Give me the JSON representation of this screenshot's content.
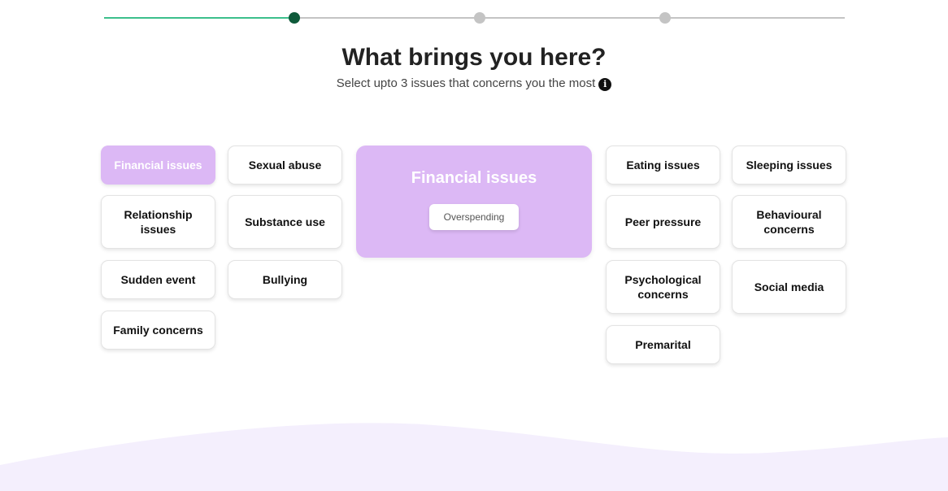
{
  "progress": {
    "current_step": 2,
    "total_steps": 4,
    "fill_fraction": 0.257
  },
  "header": {
    "title": "What brings you here?",
    "subtitle": "Select upto 3 issues that concerns you the most",
    "info_icon": "info-icon"
  },
  "issues_left": [
    {
      "label": "Financial issues",
      "selected": true
    },
    {
      "label": "Sexual abuse",
      "selected": false
    },
    {
      "label": "Relationship issues",
      "selected": false
    },
    {
      "label": "Substance use",
      "selected": false
    },
    {
      "label": "Sudden event",
      "selected": false
    },
    {
      "label": "Bullying",
      "selected": false
    },
    {
      "label": "Family concerns",
      "selected": false
    }
  ],
  "detail": {
    "title": "Financial issues",
    "subissues": [
      "Overspending"
    ]
  },
  "issues_right": [
    {
      "label": "Eating issues",
      "selected": false
    },
    {
      "label": "Sleeping issues",
      "selected": false
    },
    {
      "label": "Peer pressure",
      "selected": false
    },
    {
      "label": "Behavioural concerns",
      "selected": false
    },
    {
      "label": "Psychological concerns",
      "selected": false
    },
    {
      "label": "Social media",
      "selected": false
    },
    {
      "label": "Premarital",
      "selected": false
    }
  ],
  "colors": {
    "accent_green": "#3cbf8c",
    "step_done": "#0f5a3a",
    "step_pending": "#c4c4c4",
    "selected_purple": "#dcb8f5",
    "wave": "#f4effd"
  }
}
